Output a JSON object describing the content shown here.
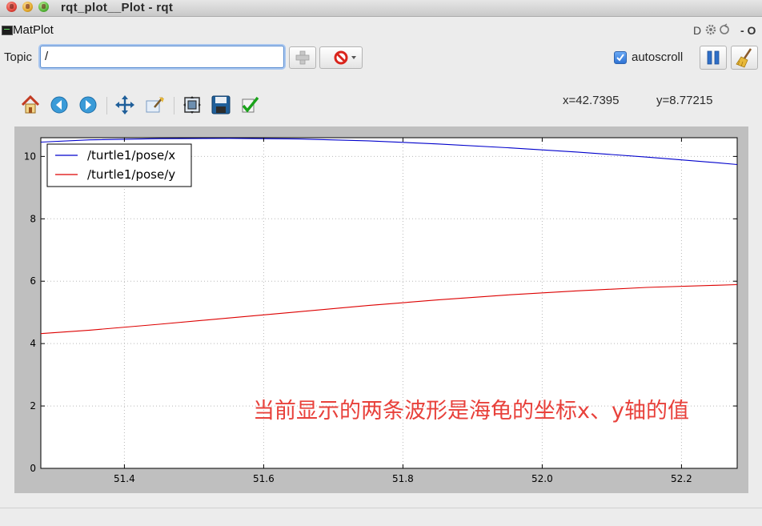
{
  "window": {
    "title": "rqt_plot__Plot - rqt"
  },
  "plugin": {
    "name": "MatPlot",
    "ctrl_d": "D",
    "ctrl_close": "- O"
  },
  "topic": {
    "label": "Topic",
    "value": "/"
  },
  "autoscroll": {
    "label": "autoscroll",
    "checked": true
  },
  "toolbar": {
    "icons": [
      "home-icon",
      "back-icon",
      "forward-icon",
      "pan-icon",
      "zoom-icon",
      "subplots-icon",
      "save-icon",
      "edit-curves-icon"
    ]
  },
  "coords": {
    "x": "x=42.7395",
    "y": "y=8.77215"
  },
  "annotation": {
    "text": "当前显示的两条波形是海龟的坐标x、y轴的值",
    "color": "#e8413b"
  },
  "chart_data": {
    "type": "line",
    "xlim": [
      51.28,
      52.28
    ],
    "ylim": [
      0,
      10.6
    ],
    "xticks": [
      51.4,
      51.6,
      51.8,
      52.0,
      52.2
    ],
    "xtick_labels": [
      "51.4",
      "51.6",
      "51.8",
      "52.0",
      "52.2"
    ],
    "yticks": [
      0,
      2,
      4,
      6,
      8,
      10
    ],
    "ytick_labels": [
      "0",
      "2",
      "4",
      "6",
      "8",
      "10"
    ],
    "grid": true,
    "legend": "top-left",
    "series": [
      {
        "name": "/turtle1/pose/x",
        "color": "#0000cc",
        "x": [
          51.28,
          51.35,
          51.45,
          51.55,
          51.65,
          51.75,
          51.85,
          51.95,
          52.05,
          52.15,
          52.25,
          52.28
        ],
        "y": [
          10.46,
          10.53,
          10.57,
          10.58,
          10.56,
          10.5,
          10.4,
          10.28,
          10.14,
          9.98,
          9.8,
          9.74
        ]
      },
      {
        "name": "/turtle1/pose/y",
        "color": "#dd0000",
        "x": [
          51.28,
          51.35,
          51.45,
          51.55,
          51.65,
          51.75,
          51.85,
          51.95,
          52.05,
          52.15,
          52.25,
          52.28
        ],
        "y": [
          4.32,
          4.43,
          4.62,
          4.82,
          5.02,
          5.22,
          5.4,
          5.56,
          5.69,
          5.8,
          5.87,
          5.89
        ]
      }
    ]
  }
}
